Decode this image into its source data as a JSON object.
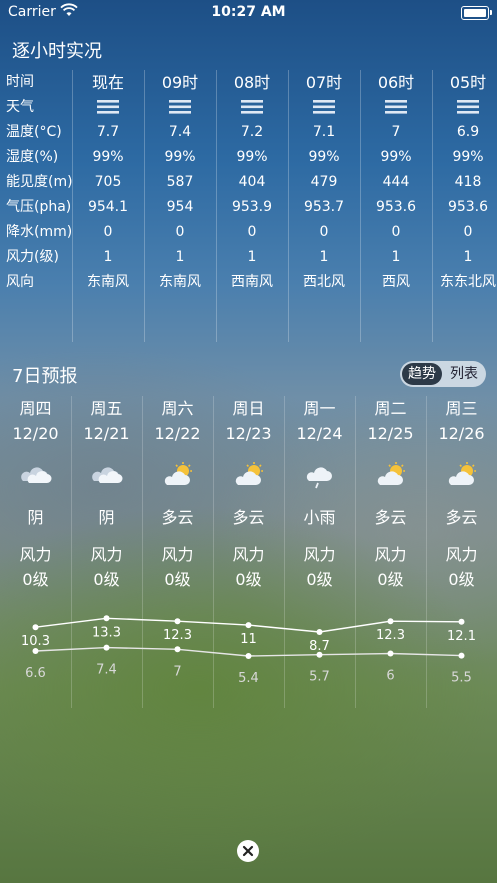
{
  "status": {
    "carrier": "Carrier",
    "time": "10:27 AM"
  },
  "hourly": {
    "title": "逐小时实况",
    "row_labels": [
      "时间",
      "天气",
      "温度(°C)",
      "湿度(%)",
      "能见度(m)",
      "气压(pha)",
      "降水(mm)",
      "风力(级)",
      "风向"
    ],
    "columns": [
      {
        "time": "现在",
        "temp": "7.7",
        "humidity": "99%",
        "visibility": "705",
        "pressure": "954.1",
        "precip": "0",
        "wind_level": "1",
        "wind_dir": "东南风"
      },
      {
        "time": "09时",
        "temp": "7.4",
        "humidity": "99%",
        "visibility": "587",
        "pressure": "954",
        "precip": "0",
        "wind_level": "1",
        "wind_dir": "东南风"
      },
      {
        "time": "08时",
        "temp": "7.2",
        "humidity": "99%",
        "visibility": "404",
        "pressure": "953.9",
        "precip": "0",
        "wind_level": "1",
        "wind_dir": "西南风"
      },
      {
        "time": "07时",
        "temp": "7.1",
        "humidity": "99%",
        "visibility": "479",
        "pressure": "953.7",
        "precip": "0",
        "wind_level": "1",
        "wind_dir": "西北风"
      },
      {
        "time": "06时",
        "temp": "7",
        "humidity": "99%",
        "visibility": "444",
        "pressure": "953.6",
        "precip": "0",
        "wind_level": "1",
        "wind_dir": "西风"
      },
      {
        "time": "05时",
        "temp": "6.9",
        "humidity": "99%",
        "visibility": "418",
        "pressure": "953.6",
        "precip": "0",
        "wind_level": "1",
        "wind_dir": "东东北风"
      }
    ],
    "weather_icon": "fog-icon"
  },
  "forecast": {
    "title": "7日预报",
    "toggle": {
      "active": "趋势",
      "inactive": "列表"
    },
    "days": [
      {
        "weekday": "周四",
        "date": "12/20",
        "desc": "阴",
        "icon": "overcast-icon",
        "wind_label": "风力",
        "wind_level": "0级",
        "high": 10.3,
        "low": 6.6
      },
      {
        "weekday": "周五",
        "date": "12/21",
        "desc": "阴",
        "icon": "overcast-icon",
        "wind_label": "风力",
        "wind_level": "0级",
        "high": 13.3,
        "low": 7.4
      },
      {
        "weekday": "周六",
        "date": "12/22",
        "desc": "多云",
        "icon": "partly-cloudy-icon",
        "wind_label": "风力",
        "wind_level": "0级",
        "high": 12.3,
        "low": 7
      },
      {
        "weekday": "周日",
        "date": "12/23",
        "desc": "多云",
        "icon": "partly-cloudy-icon",
        "wind_label": "风力",
        "wind_level": "0级",
        "high": 11,
        "low": 5.4
      },
      {
        "weekday": "周一",
        "date": "12/24",
        "desc": "小雨",
        "icon": "light-rain-icon",
        "wind_label": "风力",
        "wind_level": "0级",
        "high": 8.7,
        "low": 5.7
      },
      {
        "weekday": "周二",
        "date": "12/25",
        "desc": "多云",
        "icon": "partly-cloudy-icon",
        "wind_label": "风力",
        "wind_level": "0级",
        "high": 12.3,
        "low": 6
      },
      {
        "weekday": "周三",
        "date": "12/26",
        "desc": "多云",
        "icon": "partly-cloudy-icon",
        "wind_label": "风力",
        "wind_level": "0级",
        "high": 12.1,
        "low": 5.5
      }
    ]
  },
  "colors": {
    "sky_top": "#1d4f86",
    "toggle_active": "#2d3a48"
  }
}
